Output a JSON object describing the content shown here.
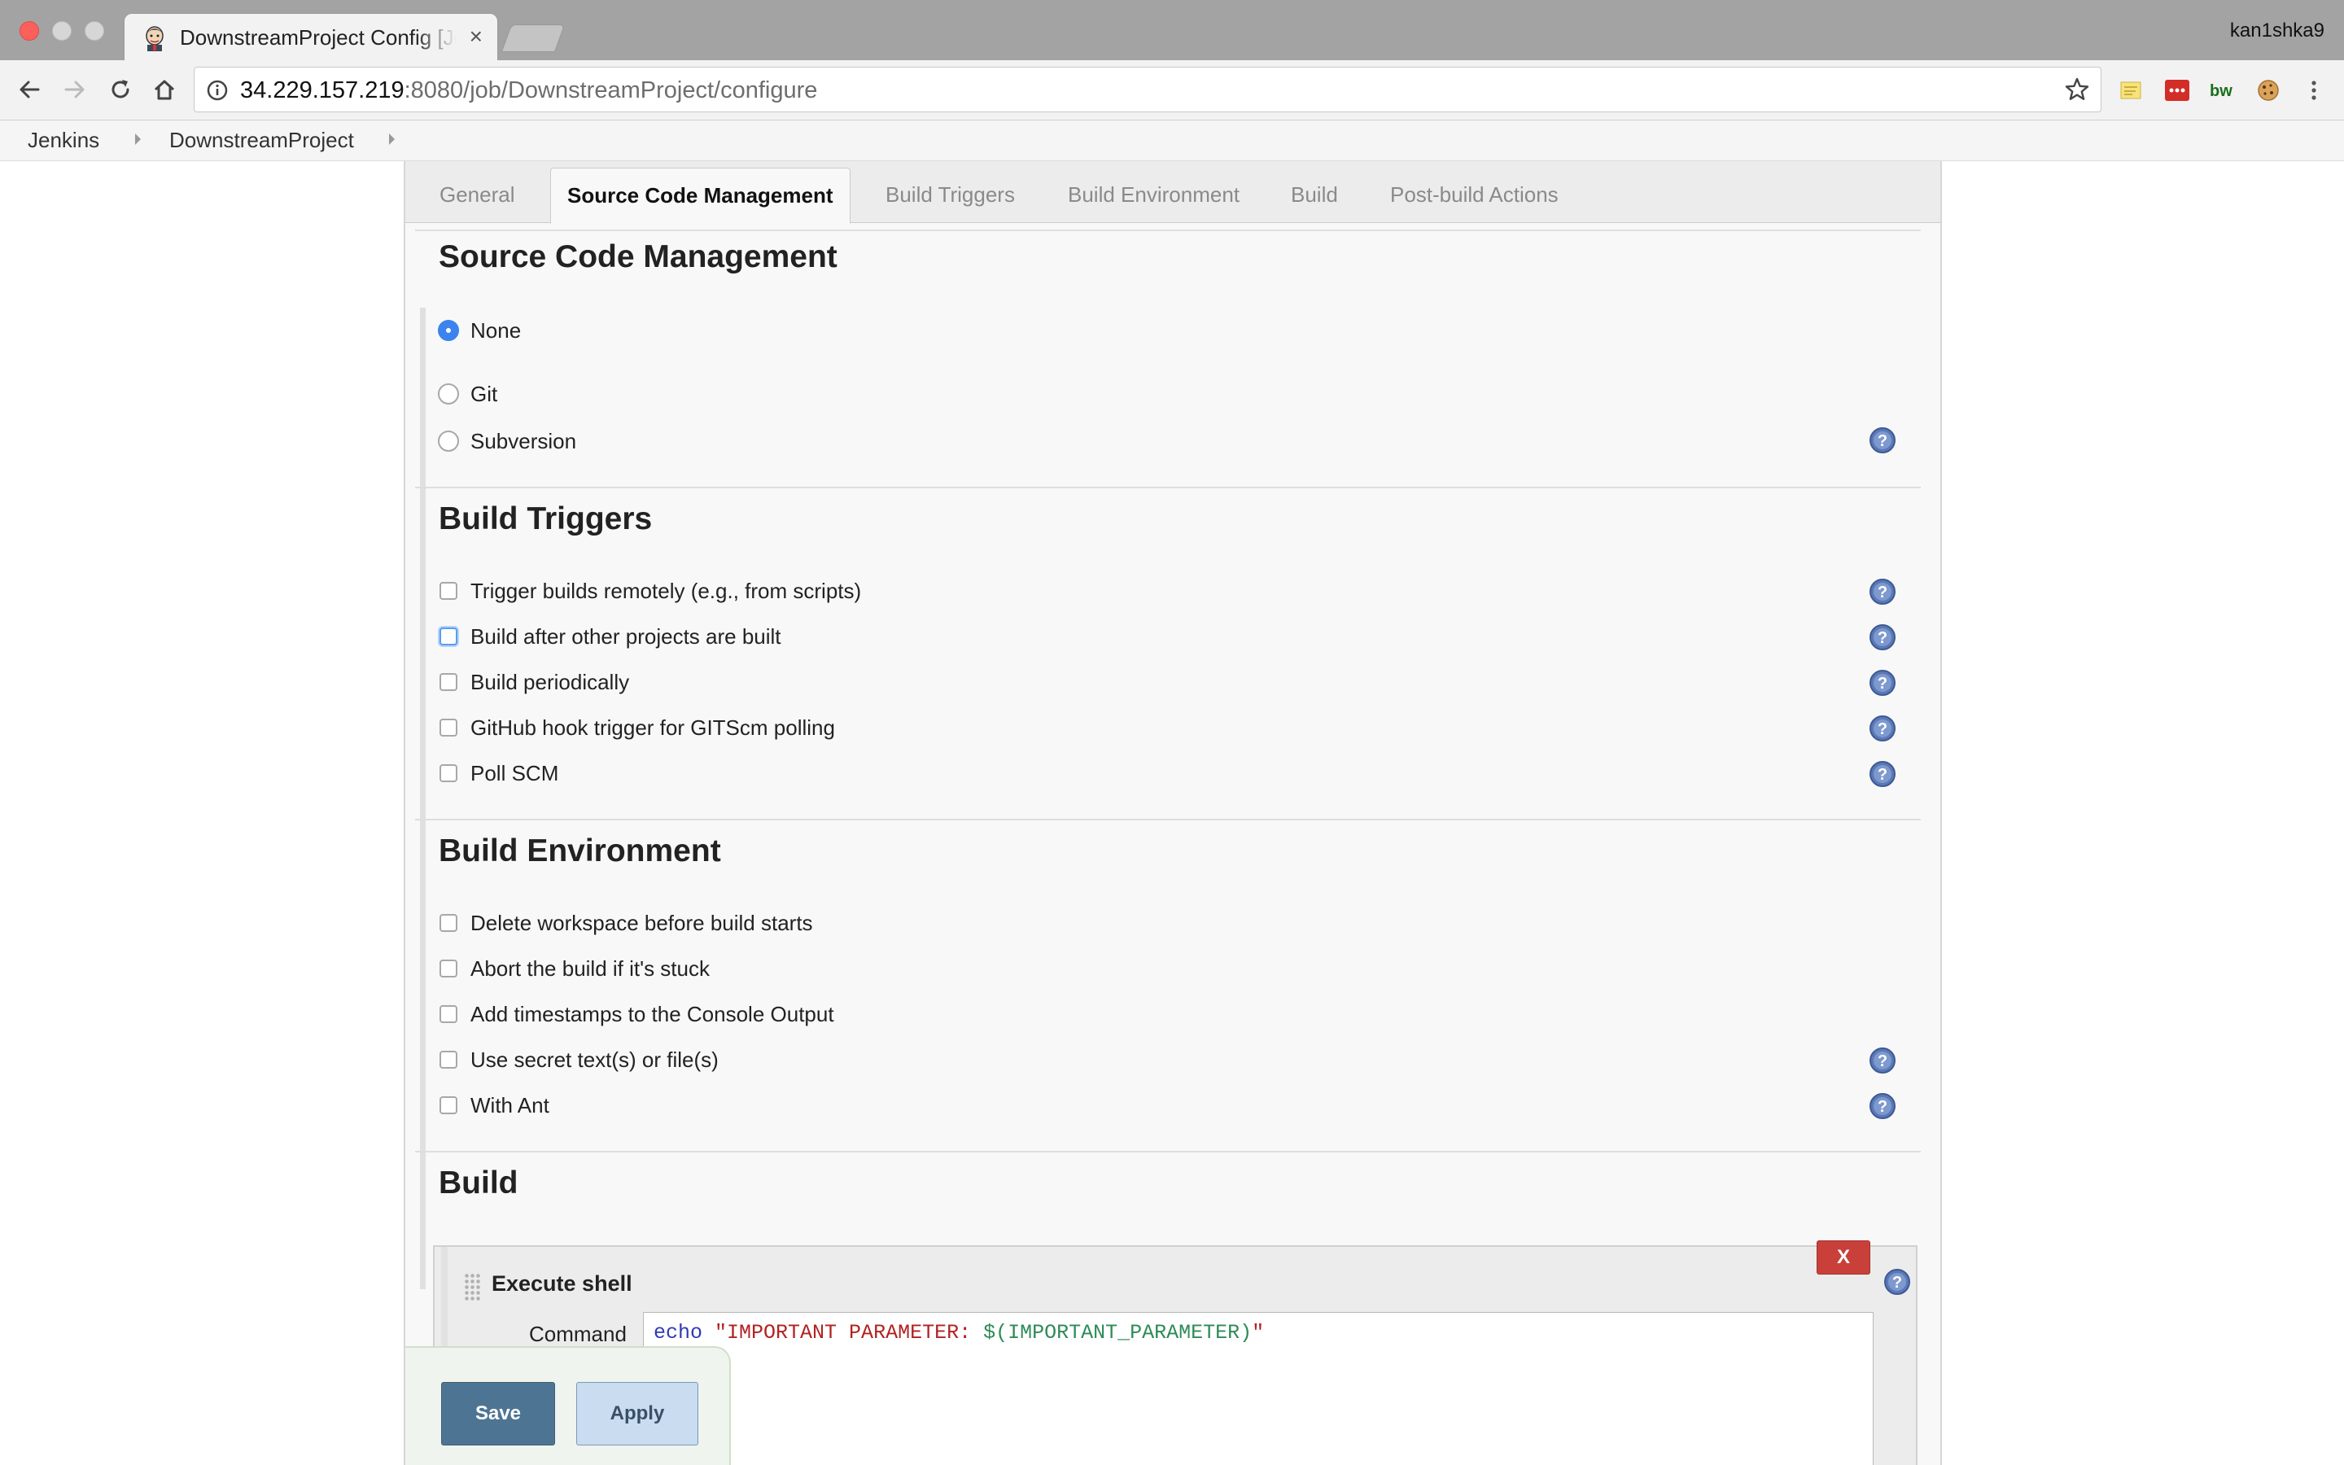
{
  "browser": {
    "tab_title": "DownstreamProject Config [Jenkins]",
    "profile_name": "kan1shka9",
    "url_host": "34.229.157.219",
    "url_path": ":8080/job/DownstreamProject/configure"
  },
  "breadcrumbs": [
    "Jenkins",
    "DownstreamProject"
  ],
  "tabs": [
    "General",
    "Source Code Management",
    "Build Triggers",
    "Build Environment",
    "Build",
    "Post-build Actions"
  ],
  "active_tab": "Source Code Management",
  "scm": {
    "title": "Source Code Management",
    "options": [
      "None",
      "Git",
      "Subversion"
    ],
    "selected": "None"
  },
  "build_triggers": {
    "title": "Build Triggers",
    "options": [
      "Trigger builds remotely (e.g., from scripts)",
      "Build after other projects are built",
      "Build periodically",
      "GitHub hook trigger for GITScm polling",
      "Poll SCM"
    ]
  },
  "build_environment": {
    "title": "Build Environment",
    "options": [
      "Delete workspace before build starts",
      "Abort the build if it's stuck",
      "Add timestamps to the Console Output",
      "Use secret text(s) or file(s)",
      "With Ant"
    ]
  },
  "build": {
    "title": "Build",
    "step_title": "Execute shell",
    "delete_label": "X",
    "command_label": "Command",
    "command": {
      "keyword": "echo",
      "space": " ",
      "string_open": "\"IMPORTANT PARAMETER: ",
      "variable": "$(IMPORTANT_PARAMETER)",
      "string_close": "\""
    }
  },
  "actions": {
    "save_label": "Save",
    "apply_label": "Apply"
  },
  "colors": {
    "save_button": "#4d7593",
    "apply_button": "#c9dcf0",
    "delete_button": "#c9403a",
    "radio_checked": "#3b83ef"
  }
}
